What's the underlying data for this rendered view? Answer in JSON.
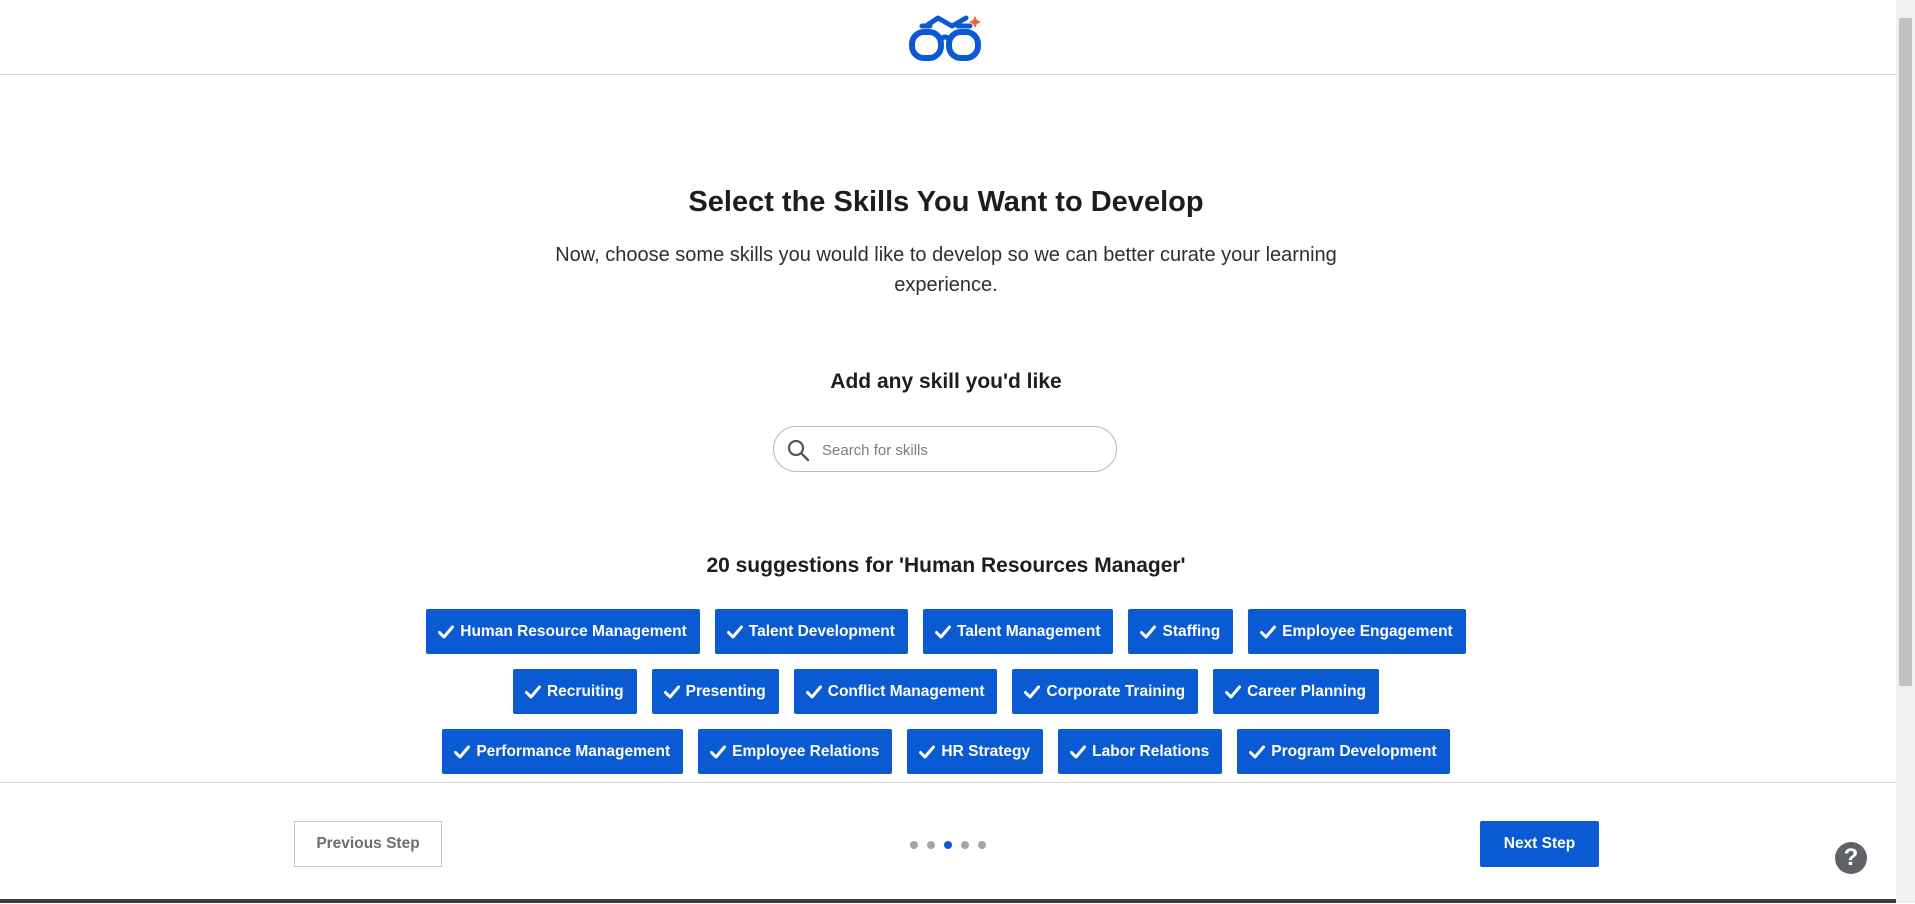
{
  "header": {
    "logo_icon": "glasses-logo-icon",
    "accent_color": "#0a5bd3",
    "spark_color": "#e8663a"
  },
  "main": {
    "title": "Select the Skills You Want to Develop",
    "subtitle": "Now, choose some skills you would like to develop so we can better curate your learning experience.",
    "add_label": "Add any skill you'd like",
    "search": {
      "placeholder": "Search for skills",
      "value": "",
      "icon": "search-icon"
    },
    "suggestions_title": "20 suggestions for 'Human Resources Manager'",
    "suggestion_rows": [
      [
        {
          "label": "Human Resource Management",
          "selected": true
        },
        {
          "label": "Talent Development",
          "selected": true
        },
        {
          "label": "Talent Management",
          "selected": true
        },
        {
          "label": "Staffing",
          "selected": true
        },
        {
          "label": "Employee Engagement",
          "selected": true
        }
      ],
      [
        {
          "label": "Recruiting",
          "selected": true
        },
        {
          "label": "Presenting",
          "selected": true
        },
        {
          "label": "Conflict Management",
          "selected": true
        },
        {
          "label": "Corporate Training",
          "selected": true
        },
        {
          "label": "Career Planning",
          "selected": true
        }
      ],
      [
        {
          "label": "Performance Management",
          "selected": true
        },
        {
          "label": "Employee Relations",
          "selected": true
        },
        {
          "label": "HR Strategy",
          "selected": true
        },
        {
          "label": "Labor Relations",
          "selected": true
        },
        {
          "label": "Program Development",
          "selected": true
        }
      ]
    ]
  },
  "footer": {
    "previous_label": "Previous Step",
    "next_label": "Next Step",
    "steps_total": 5,
    "current_step": 3,
    "help_label": "?"
  }
}
